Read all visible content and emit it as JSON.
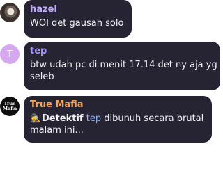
{
  "messages": [
    {
      "author": "hazel",
      "author_color": "#c3a9ff",
      "avatar": "photo",
      "text": "WOI det gausah solo"
    },
    {
      "author": "tep",
      "author_color": "#a996ff",
      "avatar_letter": "T",
      "text": "btw udah pc di menit 17.14 det ny aja yg seleb"
    },
    {
      "author": "True Mafia",
      "author_color": "#f2a35b",
      "avatar_line1": "True",
      "avatar_line2": "Mafia",
      "emoji": "detective-emoji",
      "role": "Detektif",
      "mention": "tep",
      "text_rest": " dibunuh secara brutal malam ini..."
    }
  ]
}
